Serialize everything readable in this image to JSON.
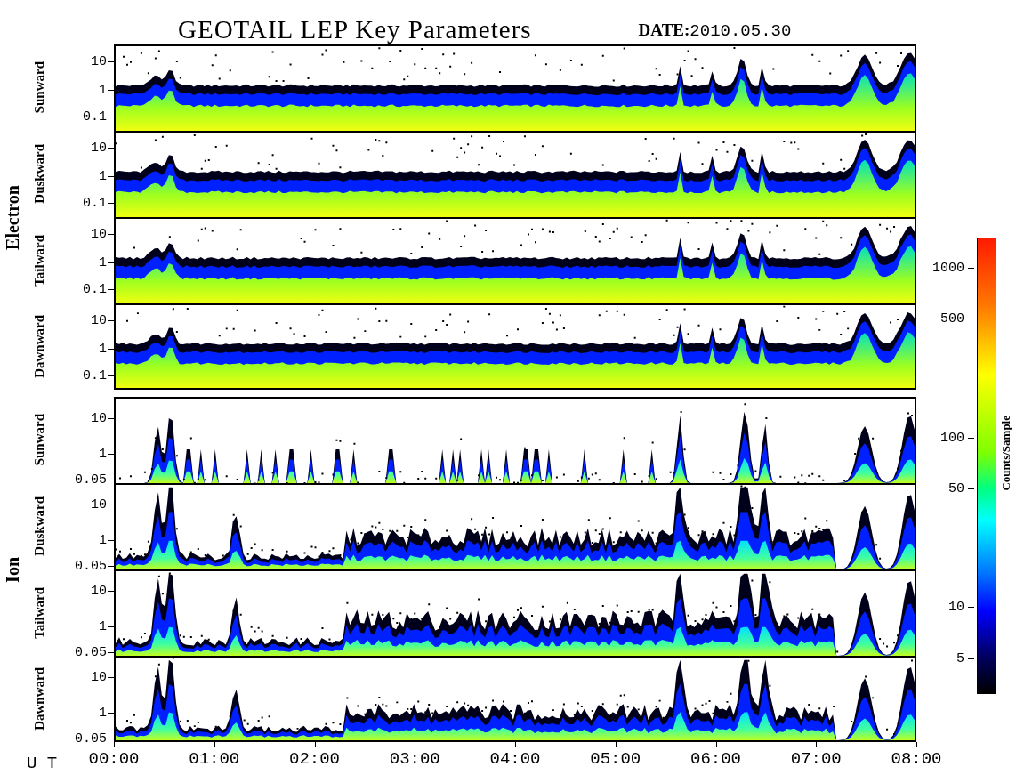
{
  "title": "GEOTAIL LEP Key Parameters",
  "date_label": "DATE:",
  "date": "2010.05.30",
  "groups": [
    {
      "name": "Electron",
      "kind": "electron",
      "panels": [
        {
          "label": "Sunward",
          "yticks": [
            "10",
            "1",
            "0.1"
          ]
        },
        {
          "label": "Duskward",
          "yticks": [
            "10",
            "1",
            "0.1"
          ]
        },
        {
          "label": "Tailward",
          "yticks": [
            "10",
            "1",
            "0.1"
          ]
        },
        {
          "label": "Dawnward",
          "yticks": [
            "10",
            "1",
            "0.1"
          ]
        }
      ]
    },
    {
      "name": "Ion",
      "kind": "ion",
      "panels": [
        {
          "label": "Sunward",
          "yticks": [
            "10",
            "1",
            "0.05"
          ]
        },
        {
          "label": "Duskward",
          "yticks": [
            "10",
            "1",
            "0.05"
          ]
        },
        {
          "label": "Tailward",
          "yticks": [
            "10",
            "1",
            "0.05"
          ]
        },
        {
          "label": "Dawnward",
          "yticks": [
            "10",
            "1",
            "0.05"
          ]
        }
      ]
    }
  ],
  "xaxis": {
    "label": "U T",
    "ticks": [
      "00:00",
      "01:00",
      "02:00",
      "03:00",
      "04:00",
      "05:00",
      "06:00",
      "07:00",
      "08:00"
    ]
  },
  "colorbar": {
    "label": "Counts/Sample",
    "ticks": [
      "1000",
      "500",
      "100",
      "50",
      "10",
      "5"
    ]
  }
}
